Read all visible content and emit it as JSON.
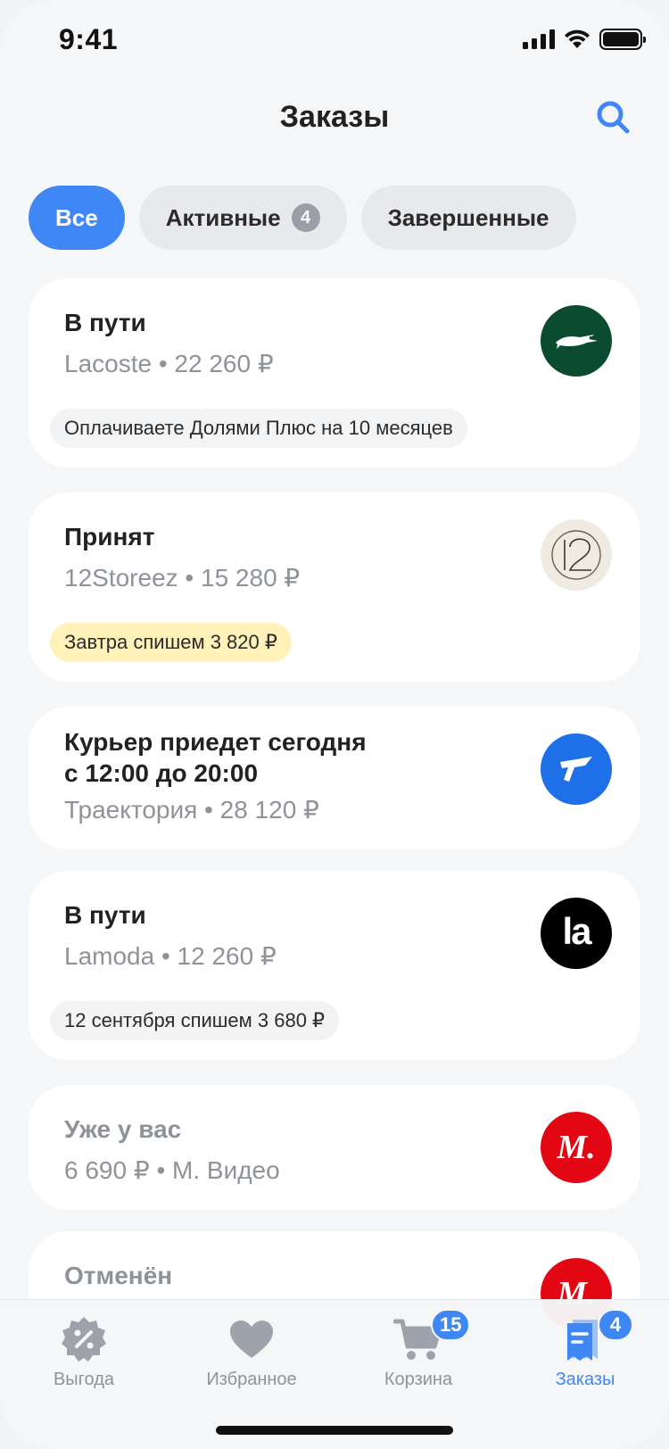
{
  "status_bar": {
    "time": "9:41"
  },
  "header": {
    "title": "Заказы"
  },
  "tabs": [
    {
      "label": "Все",
      "active": true
    },
    {
      "label": "Активные",
      "count": "4",
      "active": false
    },
    {
      "label": "Завершенные",
      "active": false
    }
  ],
  "orders": [
    {
      "status": "В пути",
      "subtitle": "Lacoste • 22 260 ₽",
      "note": "Оплачиваете Долями Плюс на 10 месяцев",
      "logo": "lacoste-logo"
    },
    {
      "status": "Принят",
      "subtitle": "12Storeez • 15 280 ₽",
      "note": "Завтра спишем 3 820 ₽",
      "logo": "12storeez-logo"
    },
    {
      "status_line1": "Курьер приедет сегодня",
      "status_line2": "с 12:00 до 20:00",
      "subtitle": "Траектория • 28 120 ₽",
      "logo": "traektoriya-logo"
    },
    {
      "status": "В пути",
      "subtitle": "Lamoda • 12 260 ₽",
      "note": "12 сентября спишем 3 680 ₽",
      "logo": "lamoda-logo",
      "logo_text": "la"
    },
    {
      "status": "Уже у вас",
      "subtitle": "6 690 ₽ • М. Видео",
      "logo": "mvideo-logo",
      "logo_text": "М."
    },
    {
      "status": "Отменён",
      "logo": "mvideo-logo",
      "logo_text": "М."
    }
  ],
  "bottom_nav": [
    {
      "label": "Выгода",
      "icon": "discount-icon"
    },
    {
      "label": "Избранное",
      "icon": "heart-icon"
    },
    {
      "label": "Корзина",
      "icon": "cart-icon",
      "badge": "15"
    },
    {
      "label": "Заказы",
      "icon": "orders-icon",
      "badge": "4",
      "active": true
    }
  ],
  "colors": {
    "accent": "#3f87f5",
    "lacoste": "#0b4b2f",
    "traektoriya": "#1f6fe8",
    "mvideo": "#e30613",
    "warning_bg": "#fff1b8"
  }
}
